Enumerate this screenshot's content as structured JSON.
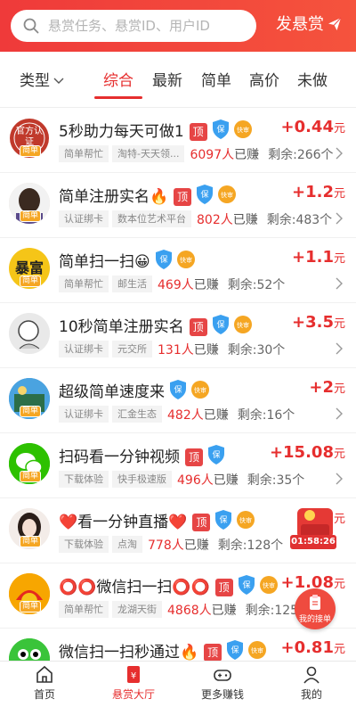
{
  "header": {
    "search_placeholder": "悬赏任务、悬赏ID、用户ID",
    "publish_label": "发悬赏"
  },
  "filter": {
    "type_label": "类型"
  },
  "tabs": [
    {
      "label": "综合",
      "active": true
    },
    {
      "label": "最新",
      "active": false
    },
    {
      "label": "简单",
      "active": false
    },
    {
      "label": "高价",
      "active": false
    },
    {
      "label": "未做",
      "active": false
    }
  ],
  "tasks": [
    {
      "title": "5秒助力每天可做1",
      "tags": [
        "简单帮忙",
        "淘特-天天领..."
      ],
      "earned_count": "6097人",
      "earned_suffix": "已赚",
      "remaining": "剩余:266个",
      "price": "+0.44",
      "unit": "元",
      "top": true,
      "kuai": true,
      "avatar_text": "官方认证"
    },
    {
      "title": "简单注册实名🔥",
      "tags": [
        "认证绑卡",
        "数本位艺术平台"
      ],
      "earned_count": "802人",
      "earned_suffix": "已赚",
      "remaining": "剩余:483个",
      "price": "+1.2",
      "unit": "元",
      "top": true,
      "kuai": true,
      "avatar_text": ""
    },
    {
      "title": "简单扫一扫😀",
      "tags": [
        "简单帮忙",
        "邮生活"
      ],
      "earned_count": "469人",
      "earned_suffix": "已赚",
      "remaining": "剩余:52个",
      "price": "+1.1",
      "unit": "元",
      "top": false,
      "kuai": true,
      "avatar_text": "暴富"
    },
    {
      "title": "10秒简单注册实名",
      "tags": [
        "认证绑卡",
        "元交所"
      ],
      "earned_count": "131人",
      "earned_suffix": "已赚",
      "remaining": "剩余:30个",
      "price": "+3.5",
      "unit": "元",
      "top": true,
      "kuai": true,
      "avatar_text": ""
    },
    {
      "title": "超级简单速度来",
      "tags": [
        "认证绑卡",
        "汇金生态"
      ],
      "earned_count": "482人",
      "earned_suffix": "已赚",
      "remaining": "剩余:16个",
      "price": "+2",
      "unit": "元",
      "top": false,
      "kuai": true,
      "avatar_text": ""
    },
    {
      "title": "扫码看一分钟视频",
      "tags": [
        "下载体验",
        "快手极速版"
      ],
      "earned_count": "496人",
      "earned_suffix": "已赚",
      "remaining": "剩余:35个",
      "price": "+15.08",
      "unit": "元",
      "top": true,
      "kuai": false,
      "avatar_text": ""
    },
    {
      "title": "❤️看一分钟直播❤️",
      "tags": [
        "下载体验",
        "点淘"
      ],
      "earned_count": "778人",
      "earned_suffix": "已赚",
      "remaining": "剩余:128个",
      "price": "+",
      "unit": "元",
      "top": true,
      "kuai": true,
      "avatar_text": ""
    },
    {
      "title": "⭕⭕微信扫一扫⭕⭕",
      "tags": [
        "简单帮忙",
        "龙湖天街"
      ],
      "earned_count": "4868人",
      "earned_suffix": "已赚",
      "remaining": "剩余:125",
      "price": "+1.08",
      "unit": "元",
      "top": true,
      "kuai": true,
      "avatar_text": ""
    },
    {
      "title": "微信扫一扫秒通过🔥",
      "tags": [],
      "earned_count": "",
      "earned_suffix": "",
      "remaining": "",
      "price": "+0.81",
      "unit": "元",
      "top": true,
      "kuai": true,
      "avatar_text": ""
    }
  ],
  "avatar_badge": "简单",
  "badge_bao": "保",
  "badge_kuai": "快审",
  "tag_top": "顶",
  "floating": {
    "timer": "01:58:26",
    "orders_label": "我的接单"
  },
  "bottom_nav": [
    {
      "label": "首页",
      "icon": "home-icon",
      "active": false
    },
    {
      "label": "悬赏大厅",
      "icon": "bounty-hall-icon",
      "active": true
    },
    {
      "label": "更多赚钱",
      "icon": "gamepad-icon",
      "active": false
    },
    {
      "label": "我的",
      "icon": "user-icon",
      "active": false
    }
  ],
  "colors": {
    "accent": "#e62e2e",
    "header": "#ef3a3a",
    "top_tag": "#e64545",
    "shield": "#3aa0f0",
    "kuai": "#f5a623"
  }
}
